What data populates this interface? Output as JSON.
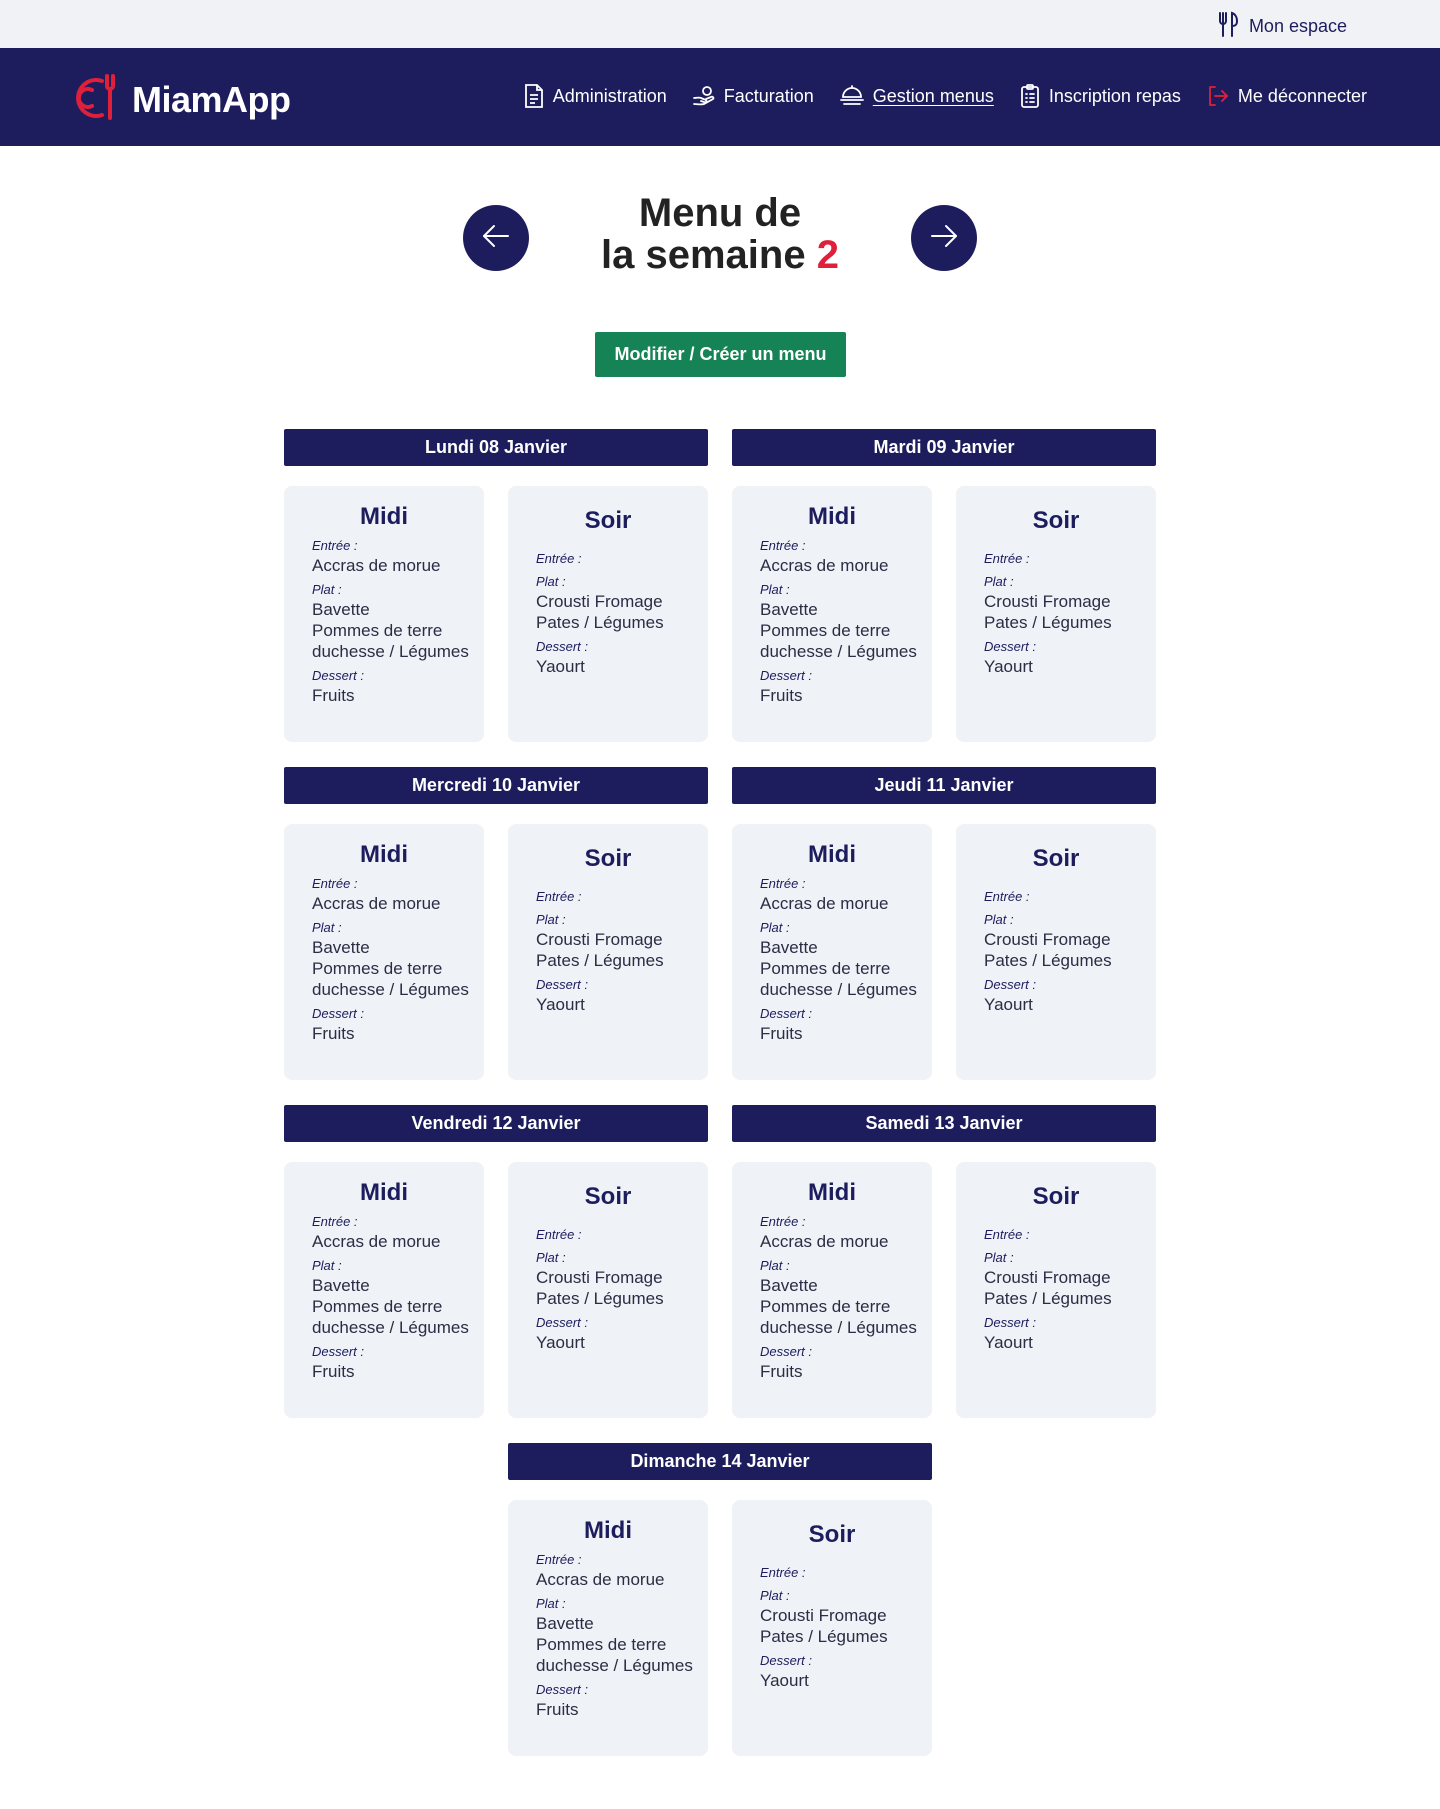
{
  "topbar": {
    "account_label": "Mon espace"
  },
  "brand": {
    "name": "MiamApp"
  },
  "nav": {
    "items": [
      {
        "label": "Administration",
        "icon": "document-icon"
      },
      {
        "label": "Facturation",
        "icon": "billing-icon"
      },
      {
        "label": "Gestion menus",
        "icon": "dish-icon",
        "active": true
      },
      {
        "label": "Inscription repas",
        "icon": "clipboard-icon"
      },
      {
        "label": "Me déconnecter",
        "icon": "logout-icon"
      }
    ]
  },
  "week": {
    "title_line1": "Menu de",
    "title_line2": "la semaine",
    "number": "2"
  },
  "cta_label": "Modifier / Créer un menu",
  "colors": {
    "navy": "#1d1d5e",
    "accent_red": "#e0203b",
    "green": "#158355",
    "card_bg": "#eff2f7"
  },
  "days": [
    {
      "label": "Lundi 08 Janvier",
      "midi": {
        "title": "Midi",
        "entree_label": "Entrée :",
        "entree": [
          "Accras de  morue"
        ],
        "plat_label": "Plat :",
        "plat": [
          "Bavette",
          "Pommes de terre",
          "duchesse / Légumes"
        ],
        "dessert_label": "Dessert :",
        "dessert": [
          "Fruits"
        ]
      },
      "soir": {
        "title": "Soir",
        "entree_label": "Entrée :",
        "entree": [],
        "plat_label": "Plat :",
        "plat": [
          "Crousti Fromage",
          "Pates / Légumes"
        ],
        "dessert_label": "Dessert :",
        "dessert": [
          "Yaourt"
        ]
      }
    },
    {
      "label": "Mardi 09 Janvier",
      "midi": {
        "title": "Midi",
        "entree_label": "Entrée :",
        "entree": [
          "Accras de  morue"
        ],
        "plat_label": "Plat :",
        "plat": [
          "Bavette",
          "Pommes de terre",
          "duchesse / Légumes"
        ],
        "dessert_label": "Dessert :",
        "dessert": [
          "Fruits"
        ]
      },
      "soir": {
        "title": "Soir",
        "entree_label": "Entrée :",
        "entree": [],
        "plat_label": "Plat :",
        "plat": [
          "Crousti Fromage",
          "Pates / Légumes"
        ],
        "dessert_label": "Dessert :",
        "dessert": [
          "Yaourt"
        ]
      }
    },
    {
      "label": "Mercredi 10 Janvier",
      "midi": {
        "title": "Midi",
        "entree_label": "Entrée :",
        "entree": [
          "Accras de  morue"
        ],
        "plat_label": "Plat :",
        "plat": [
          "Bavette",
          "Pommes de terre",
          "duchesse / Légumes"
        ],
        "dessert_label": "Dessert :",
        "dessert": [
          "Fruits"
        ]
      },
      "soir": {
        "title": "Soir",
        "entree_label": "Entrée :",
        "entree": [],
        "plat_label": "Plat :",
        "plat": [
          "Crousti Fromage",
          "Pates / Légumes"
        ],
        "dessert_label": "Dessert :",
        "dessert": [
          "Yaourt"
        ]
      }
    },
    {
      "label": "Jeudi 11 Janvier",
      "midi": {
        "title": "Midi",
        "entree_label": "Entrée :",
        "entree": [
          "Accras de  morue"
        ],
        "plat_label": "Plat :",
        "plat": [
          "Bavette",
          "Pommes de terre",
          "duchesse / Légumes"
        ],
        "dessert_label": "Dessert :",
        "dessert": [
          "Fruits"
        ]
      },
      "soir": {
        "title": "Soir",
        "entree_label": "Entrée :",
        "entree": [],
        "plat_label": "Plat :",
        "plat": [
          "Crousti Fromage",
          "Pates / Légumes"
        ],
        "dessert_label": "Dessert :",
        "dessert": [
          "Yaourt"
        ]
      }
    },
    {
      "label": "Vendredi 12 Janvier",
      "midi": {
        "title": "Midi",
        "entree_label": "Entrée :",
        "entree": [
          "Accras de  morue"
        ],
        "plat_label": "Plat :",
        "plat": [
          "Bavette",
          "Pommes de terre",
          "duchesse / Légumes"
        ],
        "dessert_label": "Dessert :",
        "dessert": [
          "Fruits"
        ]
      },
      "soir": {
        "title": "Soir",
        "entree_label": "Entrée :",
        "entree": [],
        "plat_label": "Plat :",
        "plat": [
          "Crousti Fromage",
          "Pates / Légumes"
        ],
        "dessert_label": "Dessert :",
        "dessert": [
          "Yaourt"
        ]
      }
    },
    {
      "label": "Samedi 13 Janvier",
      "midi": {
        "title": "Midi",
        "entree_label": "Entrée :",
        "entree": [
          "Accras de  morue"
        ],
        "plat_label": "Plat :",
        "plat": [
          "Bavette",
          "Pommes de terre",
          "duchesse / Légumes"
        ],
        "dessert_label": "Dessert :",
        "dessert": [
          "Fruits"
        ]
      },
      "soir": {
        "title": "Soir",
        "entree_label": "Entrée :",
        "entree": [],
        "plat_label": "Plat :",
        "plat": [
          "Crousti Fromage",
          "Pates / Légumes"
        ],
        "dessert_label": "Dessert :",
        "dessert": [
          "Yaourt"
        ]
      }
    },
    {
      "label": "Dimanche 14 Janvier",
      "midi": {
        "title": "Midi",
        "entree_label": "Entrée :",
        "entree": [
          "Accras de  morue"
        ],
        "plat_label": "Plat :",
        "plat": [
          "Bavette",
          "Pommes de terre",
          "duchesse / Légumes"
        ],
        "dessert_label": "Dessert :",
        "dessert": [
          "Fruits"
        ]
      },
      "soir": {
        "title": "Soir",
        "entree_label": "Entrée :",
        "entree": [],
        "plat_label": "Plat :",
        "plat": [
          "Crousti Fromage",
          "Pates / Légumes"
        ],
        "dessert_label": "Dessert :",
        "dessert": [
          "Yaourt"
        ]
      }
    }
  ]
}
